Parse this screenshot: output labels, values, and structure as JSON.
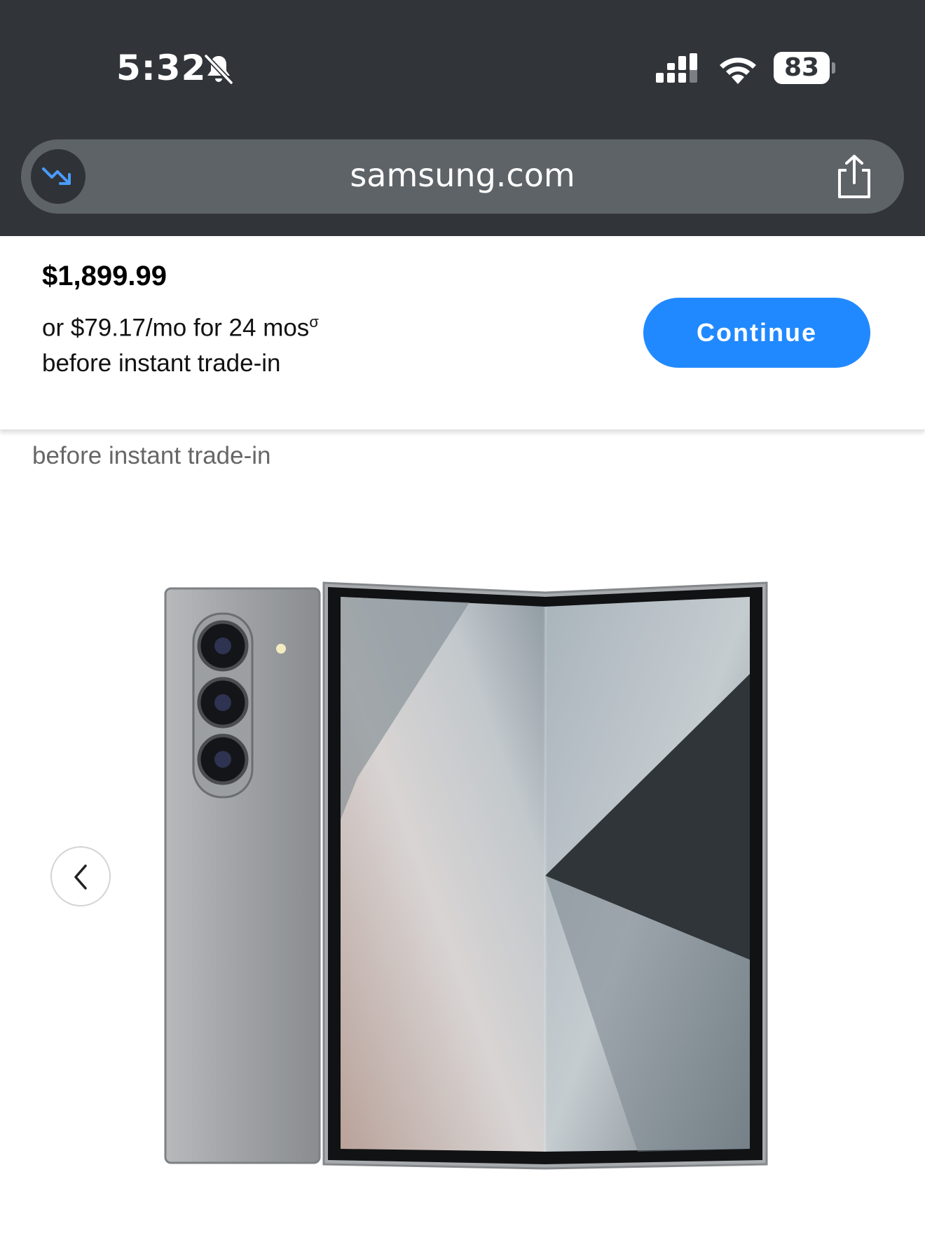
{
  "status_bar": {
    "time": "5:32",
    "battery_level": "83",
    "icons": [
      "bell-slash-icon",
      "cellular-signal-icon",
      "wifi-icon",
      "battery-icon"
    ]
  },
  "browser": {
    "url": "samsung.com",
    "icons": [
      "price-trend-down-icon",
      "share-icon"
    ],
    "trend_icon_color": "#4a9cff"
  },
  "price_bar": {
    "price": "$1,899.99",
    "monthly": "or  $79.17/mo for 24 mos",
    "monthly_footnote": "σ",
    "tradein": "before instant trade-in",
    "continue_label": "Continue",
    "accent_color": "#2189ff"
  },
  "content": {
    "tradein_note": "before instant trade-in",
    "gallery": {
      "image": "galaxy-z-fold-phone",
      "prev_icon": "chevron-left-icon"
    }
  }
}
